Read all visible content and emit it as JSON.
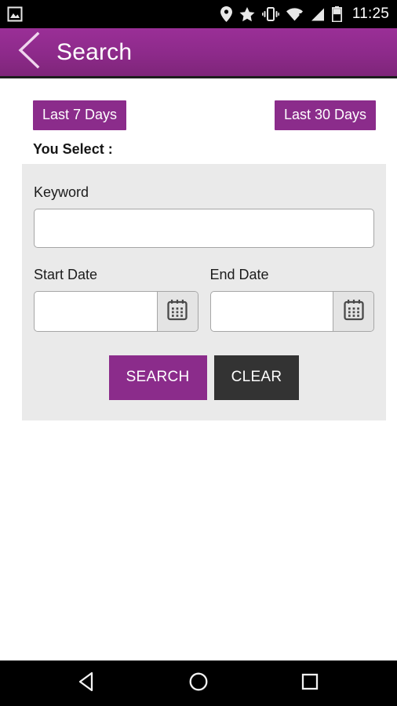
{
  "status_bar": {
    "notification_icon": "image-gallery-icon",
    "icons": [
      "location-pin-icon",
      "star-icon",
      "vibrate-icon",
      "wifi-alert-icon",
      "cell-signal-icon",
      "battery-icon"
    ],
    "time": "11:25",
    "background_color": "#000000"
  },
  "app_bar": {
    "back_icon": "back-chevron-icon",
    "title": "Search",
    "background_color": "#8d2a8a",
    "text_color": "#ffffff"
  },
  "quick_filters": {
    "last_7_days_label": "Last 7 Days",
    "last_30_days_label": "Last 30 Days",
    "button_color": "#8b2c8b"
  },
  "form": {
    "section_label": "You Select :",
    "panel_color": "#eaeaea",
    "keyword": {
      "label": "Keyword",
      "value": "",
      "placeholder": ""
    },
    "start_date": {
      "label": "Start Date",
      "value": "",
      "placeholder": "",
      "calendar_icon": "calendar-icon"
    },
    "end_date": {
      "label": "End Date",
      "value": "",
      "placeholder": "",
      "calendar_icon": "calendar-icon"
    },
    "search_label": "SEARCH",
    "clear_label": "CLEAR",
    "search_color": "#8b2c8b",
    "clear_color": "#333333"
  },
  "nav_bar": {
    "back_label": "back-triangle-icon",
    "home_label": "home-circle-icon",
    "recents_label": "recents-square-icon",
    "background_color": "#000000"
  }
}
